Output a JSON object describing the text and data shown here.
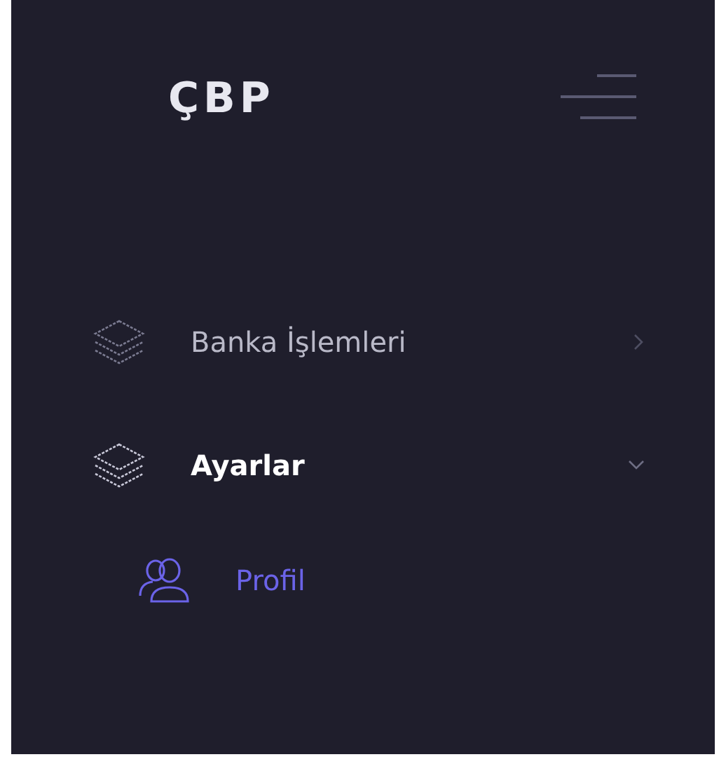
{
  "logo": "ÇBP",
  "menu": [
    {
      "label": "Banka İşlemleri",
      "expanded": false,
      "selected": false
    },
    {
      "label": "Ayarlar",
      "expanded": true,
      "selected": true,
      "children": [
        {
          "label": "Profil",
          "selected": true
        }
      ]
    }
  ]
}
